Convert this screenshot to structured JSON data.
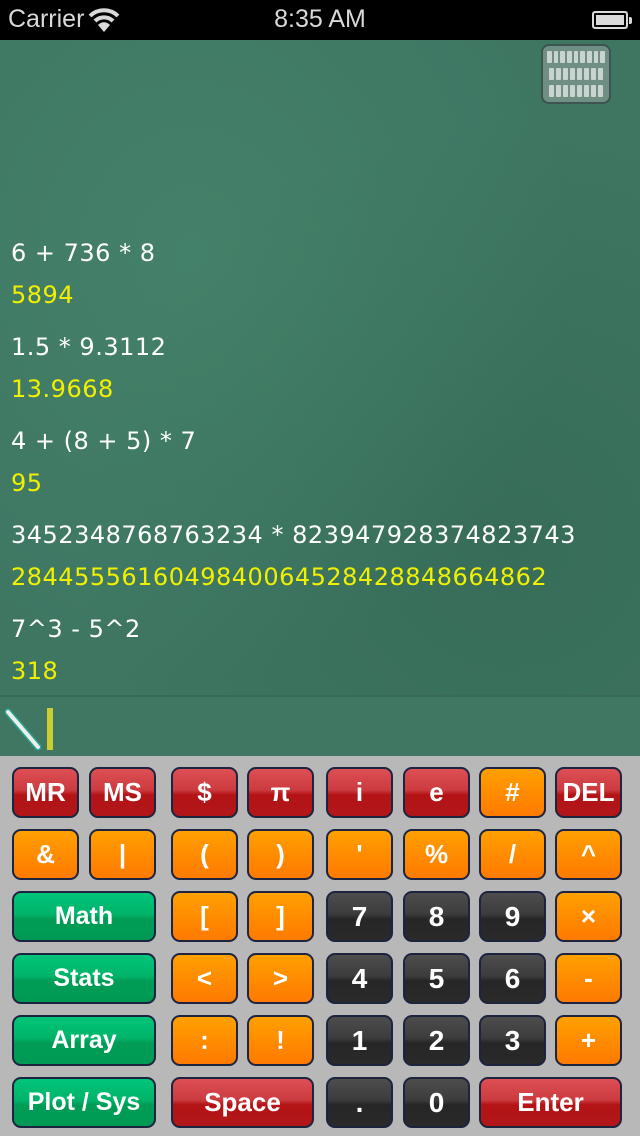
{
  "status_bar": {
    "carrier": "Carrier",
    "time": "8:35 AM",
    "wifi_icon": "wifi-icon",
    "battery_icon": "battery-icon"
  },
  "board": {
    "keyboard_toggle_icon": "keyboard-icon",
    "history": [
      {
        "expression": "6 + 736 * 8",
        "result": "5894"
      },
      {
        "expression": "1.5 * 9.3112",
        "result": "13.9668"
      },
      {
        "expression": "4 + (8 + 5) * 7",
        "result": "95"
      },
      {
        "expression": "3452348768763234 * 823947928374823743",
        "result": "2844555616049840064528428848664862"
      },
      {
        "expression": "7^3 - 5^2",
        "result": "318"
      }
    ],
    "input": {
      "value": "",
      "chalk_icon": "chalk-icon"
    }
  },
  "keypad": {
    "colors": {
      "red": "#b31316",
      "orange": "#ff8c00",
      "dark": "#2e2e2e",
      "green": "#00a85d",
      "background": "#b8b8b8"
    },
    "rows": [
      [
        {
          "label": "MR",
          "name": "memory-recall",
          "style": "red"
        },
        {
          "label": "MS",
          "name": "memory-store",
          "style": "red"
        },
        {
          "label": "$",
          "name": "dollar",
          "style": "red"
        },
        {
          "label": "π",
          "name": "pi",
          "style": "red"
        },
        {
          "label": "i",
          "name": "imaginary",
          "style": "red"
        },
        {
          "label": "e",
          "name": "euler",
          "style": "red"
        },
        {
          "label": "#",
          "name": "hash",
          "style": "orange"
        },
        {
          "label": "DEL",
          "name": "delete",
          "style": "red"
        }
      ],
      [
        {
          "label": "&",
          "name": "ampersand",
          "style": "orange"
        },
        {
          "label": "|",
          "name": "pipe",
          "style": "orange"
        },
        {
          "label": "(",
          "name": "open-paren",
          "style": "orange"
        },
        {
          "label": ")",
          "name": "close-paren",
          "style": "orange"
        },
        {
          "label": "'",
          "name": "apostrophe",
          "style": "orange"
        },
        {
          "label": "%",
          "name": "percent",
          "style": "orange"
        },
        {
          "label": "/",
          "name": "divide",
          "style": "orange"
        },
        {
          "label": "^",
          "name": "power",
          "style": "orange"
        }
      ],
      [
        {
          "label": "Math",
          "name": "math-menu",
          "style": "green"
        },
        {
          "label": "[",
          "name": "open-bracket",
          "style": "orange"
        },
        {
          "label": "]",
          "name": "close-bracket",
          "style": "orange"
        },
        {
          "label": "7",
          "name": "digit-7",
          "style": "dark"
        },
        {
          "label": "8",
          "name": "digit-8",
          "style": "dark"
        },
        {
          "label": "9",
          "name": "digit-9",
          "style": "dark"
        },
        {
          "label": "×",
          "name": "multiply",
          "style": "orange"
        }
      ],
      [
        {
          "label": "Stats",
          "name": "stats-menu",
          "style": "green"
        },
        {
          "label": "<",
          "name": "less-than",
          "style": "orange"
        },
        {
          "label": ">",
          "name": "greater-than",
          "style": "orange"
        },
        {
          "label": "4",
          "name": "digit-4",
          "style": "dark"
        },
        {
          "label": "5",
          "name": "digit-5",
          "style": "dark"
        },
        {
          "label": "6",
          "name": "digit-6",
          "style": "dark"
        },
        {
          "label": "-",
          "name": "subtract",
          "style": "orange"
        }
      ],
      [
        {
          "label": "Array",
          "name": "array-menu",
          "style": "green"
        },
        {
          "label": ":",
          "name": "colon",
          "style": "orange"
        },
        {
          "label": "!",
          "name": "factorial",
          "style": "orange"
        },
        {
          "label": "1",
          "name": "digit-1",
          "style": "dark"
        },
        {
          "label": "2",
          "name": "digit-2",
          "style": "dark"
        },
        {
          "label": "3",
          "name": "digit-3",
          "style": "dark"
        },
        {
          "label": "+",
          "name": "add",
          "style": "orange"
        }
      ],
      [
        {
          "label": "Plot / Sys",
          "name": "plot-sys-menu",
          "style": "green"
        },
        {
          "label": "Space",
          "name": "space",
          "style": "red"
        },
        {
          "label": ".",
          "name": "decimal-point",
          "style": "dark"
        },
        {
          "label": "0",
          "name": "digit-0",
          "style": "dark"
        },
        {
          "label": "Enter",
          "name": "enter",
          "style": "red"
        }
      ]
    ]
  }
}
